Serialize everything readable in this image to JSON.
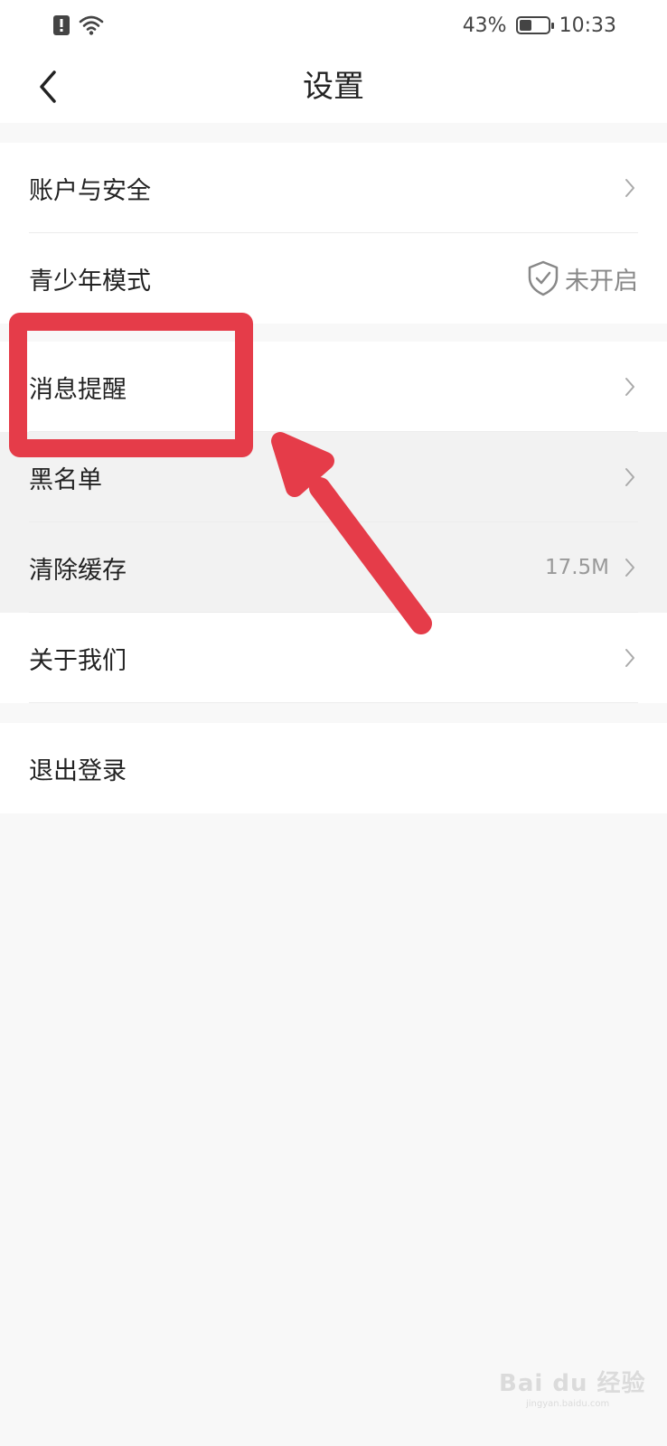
{
  "status_bar": {
    "battery_percent_text": "43%",
    "battery_level": 0.43,
    "time": "10:33",
    "icons": [
      "alert-icon",
      "wifi-icon",
      "battery-icon"
    ]
  },
  "header": {
    "back_icon": "chevron-left-icon",
    "title": "设置"
  },
  "settings": {
    "account": {
      "label": "账户与安全"
    },
    "teen_mode": {
      "label": "青少年模式",
      "value": "未开启",
      "icon": "shield-check-icon"
    },
    "notifications": {
      "label": "消息提醒"
    },
    "blacklist": {
      "label": "黑名单"
    },
    "clear_cache": {
      "label": "清除缓存",
      "value": "17.5M"
    },
    "about": {
      "label": "关于我们"
    },
    "logout": {
      "label": "退出登录"
    }
  },
  "watermark": {
    "logo": "Bai du 经验",
    "site": "jingyan.baidu.com"
  },
  "colors": {
    "annotation": "#e53c49",
    "background": "#f8f8f8",
    "row_bg": "#ffffff",
    "dim_bg": "#f2f2f2"
  }
}
